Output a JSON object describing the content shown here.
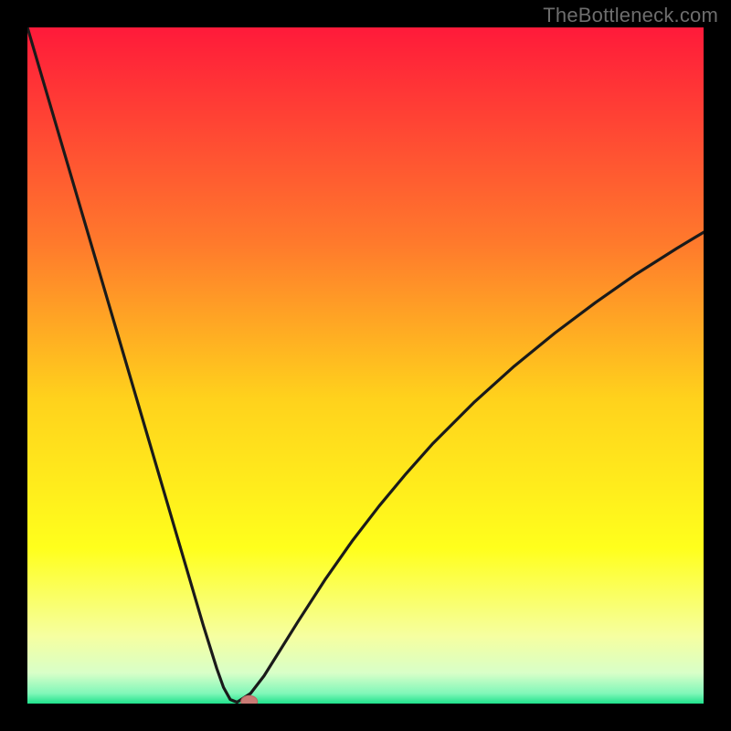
{
  "watermark": "TheBottleneck.com",
  "chart_data": {
    "type": "line",
    "title": "",
    "xlabel": "",
    "ylabel": "",
    "xlim": [
      0,
      100
    ],
    "ylim": [
      0,
      100
    ],
    "x": [
      0,
      2,
      4,
      6,
      8,
      10,
      12,
      14,
      16,
      18,
      20,
      22,
      24,
      26,
      28,
      29,
      30,
      31,
      33,
      35,
      37,
      40,
      44,
      48,
      52,
      56,
      60,
      66,
      72,
      78,
      84,
      90,
      96,
      100
    ],
    "values": [
      100,
      93.2,
      86.4,
      79.6,
      72.8,
      66,
      59.2,
      52.4,
      45.6,
      38.8,
      32,
      25.2,
      18.4,
      11.6,
      5.2,
      2.4,
      0.6,
      0.2,
      1.5,
      4.1,
      7.3,
      12.1,
      18.3,
      24,
      29.2,
      34,
      38.5,
      44.5,
      49.9,
      54.8,
      59.3,
      63.5,
      67.3,
      69.7
    ],
    "marker_point": {
      "x": 32.8,
      "y": 0.3
    },
    "background_gradient": {
      "stops": [
        {
          "offset": 0.0,
          "color": "#ff1a3a"
        },
        {
          "offset": 0.32,
          "color": "#ff7a2c"
        },
        {
          "offset": 0.55,
          "color": "#ffd21c"
        },
        {
          "offset": 0.77,
          "color": "#ffff1c"
        },
        {
          "offset": 0.9,
          "color": "#f6ffa0"
        },
        {
          "offset": 0.955,
          "color": "#d8ffc8"
        },
        {
          "offset": 0.985,
          "color": "#80f7b9"
        },
        {
          "offset": 1.0,
          "color": "#1fe28c"
        }
      ]
    },
    "curve_stroke": "#1a1a1a",
    "marker_fill": "#ca7b75",
    "marker_stroke": "#b96a64"
  },
  "layout": {
    "plot_size": 740,
    "plot_offset": 30,
    "full_size": 800
  }
}
